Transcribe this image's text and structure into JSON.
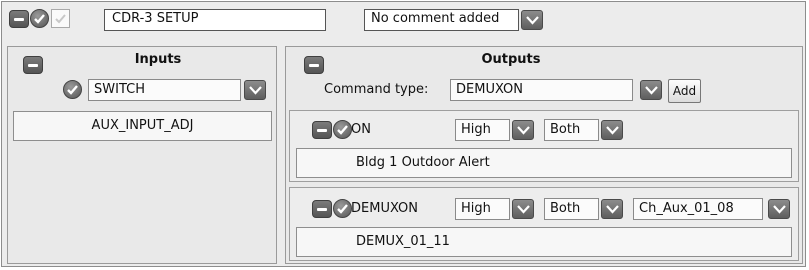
{
  "header": {
    "title_value": "CDR-3 SETUP",
    "comment_value": "No comment added"
  },
  "inputs": {
    "title": "Inputs",
    "type_value": "SWITCH",
    "items": [
      "AUX_INPUT_ADJ"
    ]
  },
  "outputs": {
    "title": "Outputs",
    "command_type_label": "Command type:",
    "command_type_value": "DEMUXON",
    "add_label": "Add",
    "commands": [
      {
        "name": "ON",
        "level": "High",
        "mode": "Both",
        "detail": "Bldg 1 Outdoor Alert"
      },
      {
        "name": "DEMUXON",
        "level": "High",
        "mode": "Both",
        "channel": "Ch_Aux_01_08",
        "detail": "DEMUX_01_11"
      }
    ]
  },
  "icons": {
    "minus": "minus-icon",
    "check": "checkmark-icon",
    "dropdown": "chevron-down-icon"
  }
}
